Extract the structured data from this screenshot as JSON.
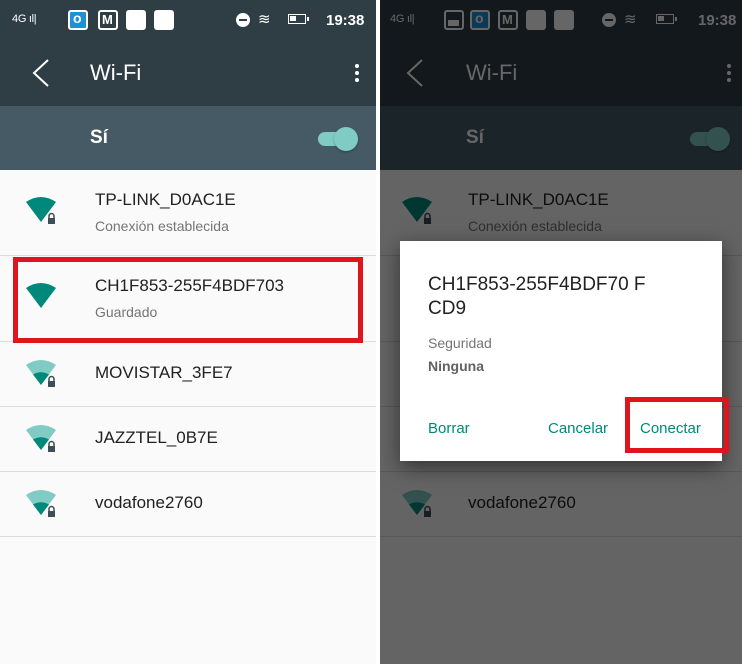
{
  "status_bar": {
    "signal_text": "4G",
    "time": "19:38",
    "notification_icons": [
      "outlook-icon",
      "mail-icon",
      "picture-icon"
    ]
  },
  "toolbar": {
    "title": "Wi-Fi",
    "back_icon": "chevron-left-icon",
    "menu_icon": "more-vertical-icon"
  },
  "wifi_switch": {
    "label": "Sí",
    "enabled": true
  },
  "networks": [
    {
      "name": "TP-LINK_D0AC1E",
      "status": "Conexión establecida",
      "secured": true
    },
    {
      "name": "CH1F853-255F4BDF703",
      "status": "Guardado",
      "secured": false
    },
    {
      "name": "MOVISTAR_3FE7",
      "status": "",
      "secured": true
    },
    {
      "name": "JAZZTEL_0B7E",
      "status": "",
      "secured": true
    },
    {
      "name": "vodafone2760",
      "status": "",
      "secured": true
    }
  ],
  "dialog": {
    "title": "CH1F853-255F4BDF70 FCD9",
    "security_label": "Seguridad",
    "security_value": "Ninguna",
    "buttons": {
      "forget": "Borrar",
      "cancel": "Cancelar",
      "connect": "Conectar"
    }
  },
  "colors": {
    "toolbar": "#2f3d45",
    "switchbar": "#455a64",
    "accent": "#00897b",
    "wifi_icon": "#00897b",
    "highlight": "#e0141c"
  }
}
